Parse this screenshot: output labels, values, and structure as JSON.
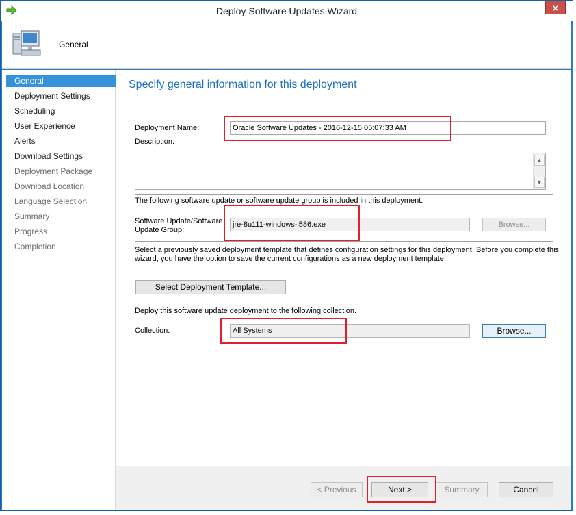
{
  "window": {
    "title": "Deploy Software Updates Wizard",
    "close_glyph": "✕"
  },
  "header": {
    "label": "General",
    "icon": "computer-icon"
  },
  "nav": {
    "items": [
      {
        "label": "General",
        "state": "active"
      },
      {
        "label": "Deployment Settings",
        "state": "enabled"
      },
      {
        "label": "Scheduling",
        "state": "enabled"
      },
      {
        "label": "User Experience",
        "state": "enabled"
      },
      {
        "label": "Alerts",
        "state": "enabled"
      },
      {
        "label": "Download Settings",
        "state": "enabled"
      },
      {
        "label": "Deployment Package",
        "state": "disabled"
      },
      {
        "label": "Download Location",
        "state": "disabled"
      },
      {
        "label": "Language Selection",
        "state": "disabled"
      },
      {
        "label": "Summary",
        "state": "disabled"
      },
      {
        "label": "Progress",
        "state": "disabled"
      },
      {
        "label": "Completion",
        "state": "disabled"
      }
    ]
  },
  "main": {
    "heading": "Specify general information for this deployment",
    "deployment_name_label": "Deployment Name:",
    "deployment_name_value": "Oracle Software Updates - 2016-12-15 05:07:33 AM",
    "description_label": "Description:",
    "description_value": "",
    "included_text": "The following software update or software update group is included in this deployment.",
    "update_group_label_1": "Software Update/Software",
    "update_group_label_2": "Update Group:",
    "update_group_value": "jre-8u111-windows-i586.exe",
    "browse_label": "Browse...",
    "template_text_1": "Select a previously saved deployment template that defines configuration settings for this deployment. Before you complete this",
    "template_text_2": "wizard, you have the option to save the current configurations as a new deployment template.",
    "select_template_label": "Select Deployment Template...",
    "collection_text": "Deploy this software update deployment to the following collection.",
    "collection_label": "Collection:",
    "collection_value": "All Systems",
    "collection_browse_label": "Browse..."
  },
  "footer": {
    "previous_label": "< Previous",
    "next_label": "Next >",
    "summary_label": "Summary",
    "cancel_label": "Cancel"
  },
  "colors": {
    "accent": "#3592dd",
    "heading": "#1e6fbf",
    "highlight_box": "#e0202a",
    "window_border": "#2b7bc8"
  }
}
